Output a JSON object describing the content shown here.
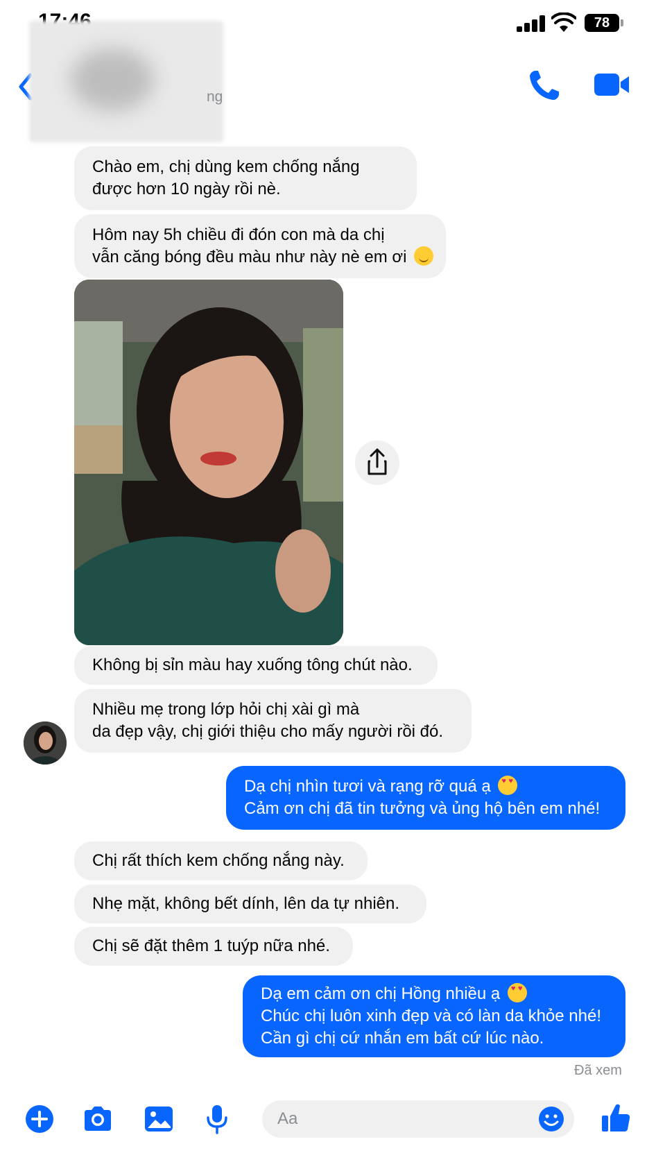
{
  "status_bar": {
    "time": "17:46",
    "battery": "78"
  },
  "header": {
    "contact_status": "ng"
  },
  "messages": {
    "m1": {
      "lines": [
        "Chào em, chị dùng kem chống nắng",
        "được hơn 10 ngày rồi nè."
      ]
    },
    "m2": {
      "lines": [
        "Hôm nay 5h chiều đi đón con mà da chị",
        "vẫn căng bóng đều màu như này nè em ơi"
      ],
      "emoji": "smiling-face"
    },
    "m3": {
      "text": "Không bị sỉn màu hay xuống tông chút nào."
    },
    "m4": {
      "lines": [
        "Nhiều mẹ trong lớp hỏi chị xài gì mà",
        "da đẹp vậy, chị giới thiệu cho mấy người rồi đó."
      ]
    },
    "m5": {
      "lines": [
        "Dạ chị nhìn tươi và rạng rỡ quá ạ",
        "Cảm ơn chị đã tin tưởng và ủng hộ bên em nhé!"
      ],
      "emoji": "heart-eyes"
    },
    "m6": {
      "text": "Chị rất thích kem chống nắng này."
    },
    "m7": {
      "text": "Nhẹ mặt, không bết dính, lên da tự nhiên."
    },
    "m8": {
      "text": "Chị sẽ đặt thêm 1 tuýp nữa nhé."
    },
    "m9": {
      "lines": [
        "Dạ em cảm ơn chị Hồng nhiều ạ",
        "Chúc chị luôn xinh đẹp và có làn da khỏe nhé!",
        "Cần gì chị cứ nhắn em bất cứ lúc nào."
      ],
      "emoji": "smiling-face-with-hearts"
    }
  },
  "seen_label": "Đã xem",
  "composer": {
    "placeholder": "Aa"
  },
  "colors": {
    "accent": "#0866ff",
    "incoming_bubble": "#f0f0f0",
    "muted_text": "#8a8d91"
  },
  "icons": [
    "back-chevron-icon",
    "phone-icon",
    "video-camera-icon",
    "share-icon",
    "plus-icon",
    "camera-icon",
    "image-icon",
    "microphone-icon",
    "emoji-icon",
    "thumbs-up-icon"
  ]
}
